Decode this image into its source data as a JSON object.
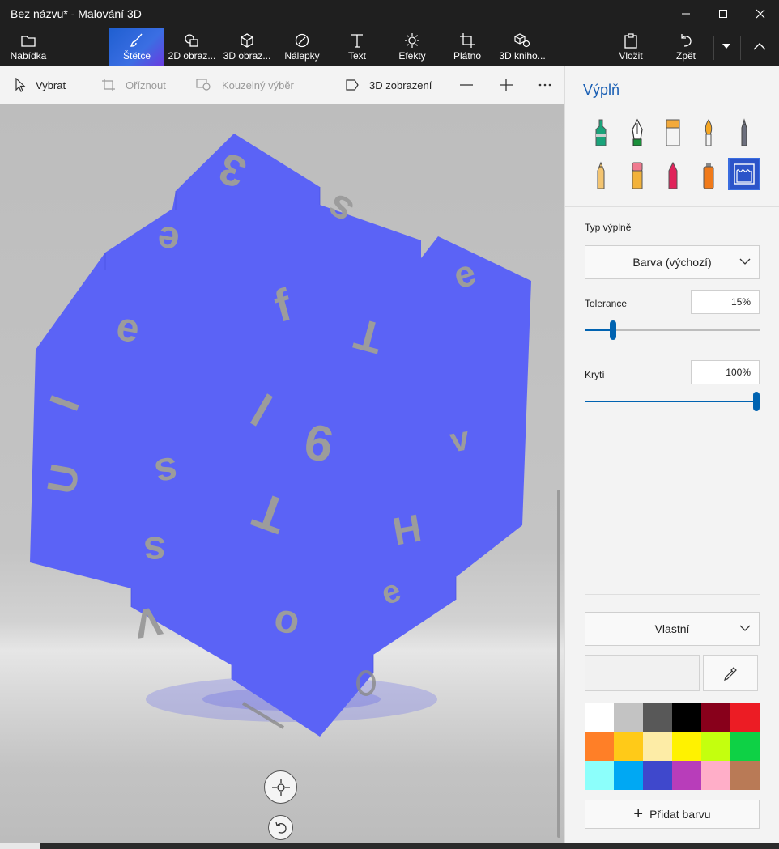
{
  "window": {
    "title": "Bez názvu* - Malování 3D"
  },
  "ribbon": {
    "menu": "Nabídka",
    "brushes": "Štětce",
    "shapes2d": "2D obraz...",
    "shapes3d": "3D obraz...",
    "stickers": "Nálepky",
    "text": "Text",
    "effects": "Efekty",
    "canvas": "Plátno",
    "library3d": "3D kniho...",
    "paste": "Vložit",
    "undo": "Zpět"
  },
  "toolbar": {
    "select": "Vybrat",
    "crop": "Oříznout",
    "magic_select": "Kouzelný výběr",
    "view3d": "3D zobrazení"
  },
  "panel": {
    "title": "Výplň",
    "fill_type_label": "Typ výplně",
    "fill_type_value": "Barva (výchozí)",
    "tolerance_label": "Tolerance",
    "tolerance_value": "15%",
    "tolerance_level": 0.15,
    "opacity_label": "Krytí",
    "opacity_value": "100%",
    "opacity_level": 1.0,
    "color_mode": "Vlastní",
    "add_color": "Přidat barvu",
    "palette": [
      "#ffffff",
      "#c3c3c3",
      "#585858",
      "#000000",
      "#88001b",
      "#ec1c24",
      "#ff7f27",
      "#ffca18",
      "#fdeca6",
      "#fff200",
      "#c4ff0e",
      "#0ed145",
      "#8cfffb",
      "#00a8f3",
      "#3f48cc",
      "#b83dba",
      "#ffaec8",
      "#b97a56"
    ]
  },
  "canvas": {
    "cube_color": "#5b63f6",
    "glyphs": [
      "3",
      "s",
      "e",
      "e",
      "f",
      "T",
      "e",
      "l",
      "v",
      "I",
      "9",
      "s",
      "T",
      "H",
      "s",
      "o",
      "e",
      "V",
      "U"
    ]
  }
}
